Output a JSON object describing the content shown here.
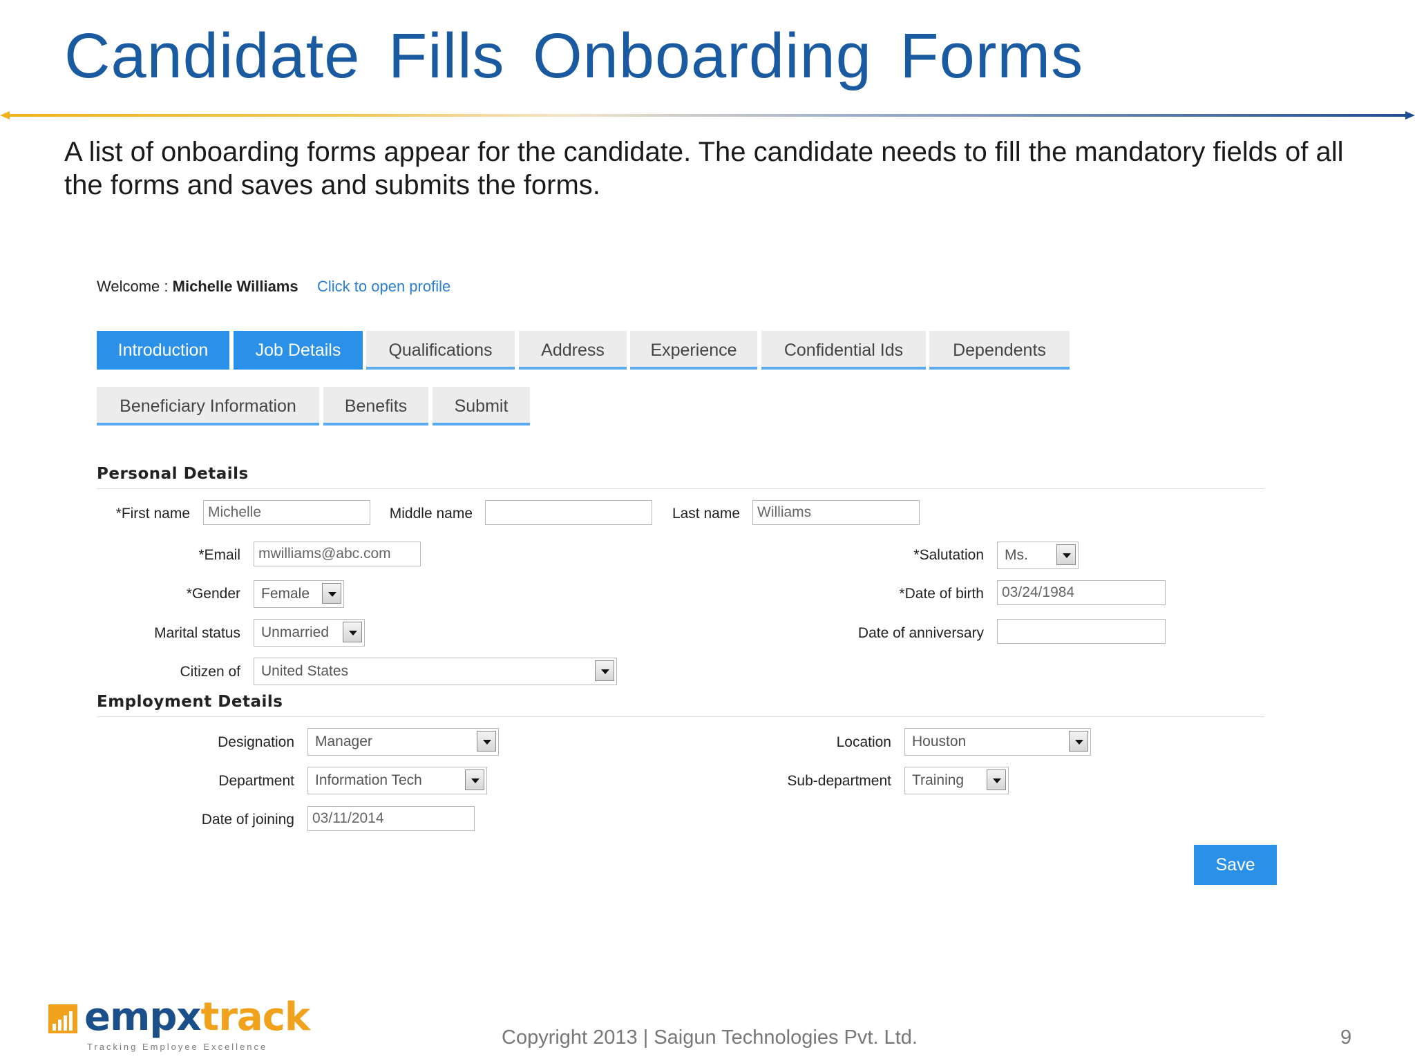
{
  "slide": {
    "title": "Candidate Fills Onboarding Forms",
    "intro": "A list of onboarding forms appear for the candidate. The candidate needs to fill the mandatory fields of all the forms and saves and submits the forms.",
    "copyright": "Copyright 2013 | Saigun Technologies Pvt. Ltd.",
    "page_number": "9"
  },
  "logo": {
    "name_part1": "empx",
    "name_part2": "track",
    "tagline": "Tracking Employee Excellence"
  },
  "header": {
    "welcome_prefix": "Welcome : ",
    "user_name": "Michelle Williams",
    "profile_link": "Click to open profile"
  },
  "tabs": [
    {
      "label": "Introduction",
      "active": true
    },
    {
      "label": "Job Details",
      "active": true
    },
    {
      "label": "Qualifications",
      "active": false
    },
    {
      "label": "Address",
      "active": false
    },
    {
      "label": "Experience",
      "active": false
    },
    {
      "label": "Confidential Ids",
      "active": false
    },
    {
      "label": "Dependents",
      "active": false
    },
    {
      "label": "Beneficiary Information",
      "active": false
    },
    {
      "label": "Benefits",
      "active": false
    },
    {
      "label": "Submit",
      "active": false
    }
  ],
  "personal": {
    "heading": "Personal Details",
    "first_name_label": "*First name",
    "first_name": "Michelle",
    "middle_name_label": "Middle name",
    "middle_name": "",
    "last_name_label": "Last name",
    "last_name": "Williams",
    "email_label": "*Email",
    "email": "mwilliams@abc.com",
    "salutation_label": "*Salutation",
    "salutation": "Ms.",
    "gender_label": "*Gender",
    "gender": "Female",
    "dob_label": "*Date of birth",
    "dob": "03/24/1984",
    "marital_label": "Marital status",
    "marital": "Unmarried",
    "anniversary_label": "Date of anniversary",
    "anniversary": "",
    "citizen_label": "Citizen of",
    "citizen": "United States"
  },
  "employment": {
    "heading": "Employment Details",
    "designation_label": "Designation",
    "designation": "Manager",
    "location_label": "Location",
    "location": "Houston",
    "department_label": "Department",
    "department": "Information Tech",
    "subdepartment_label": "Sub-department",
    "subdepartment": "Training",
    "joining_label": "Date of joining",
    "joining": "03/11/2014"
  },
  "actions": {
    "save_label": "Save"
  },
  "colors": {
    "title": "#1a5aa0",
    "tab_active": "#2b91e8",
    "link": "#2a7fd4",
    "logo_blue": "#1a4f8a",
    "logo_orange": "#f0a21c"
  }
}
